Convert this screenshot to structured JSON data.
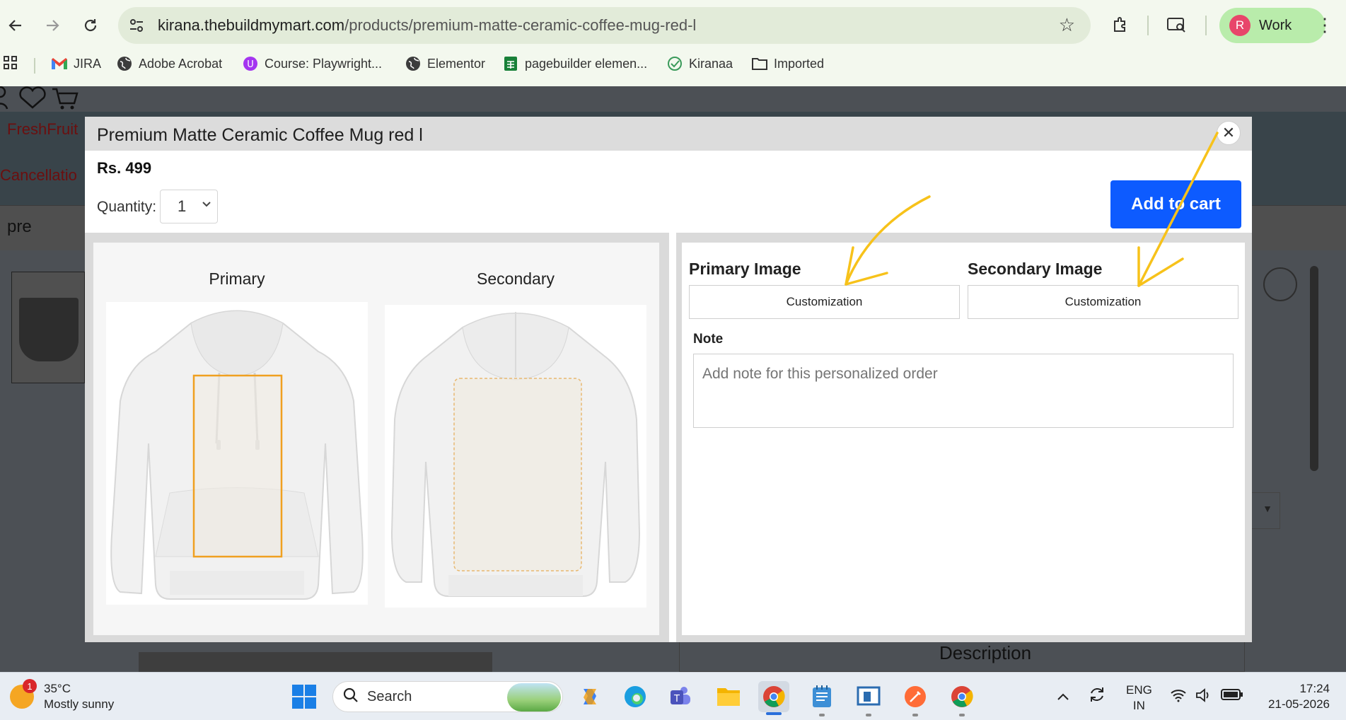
{
  "browser": {
    "url_host": "kirana.thebuildmymart.com",
    "url_path": "/products/premium-matte-ceramic-coffee-mug-red-l",
    "profile_initial": "R",
    "profile_label": "Work",
    "bookmarks": [
      {
        "label": "JIRA",
        "icon": "gmail-icon"
      },
      {
        "label": "Adobe Acrobat",
        "icon": "globe-icon"
      },
      {
        "label": "Course: Playwright...",
        "icon": "course-icon"
      },
      {
        "label": "Elementor",
        "icon": "globe-icon"
      },
      {
        "label": "pagebuilder elemen...",
        "icon": "sheets-icon"
      },
      {
        "label": "Kiranaa",
        "icon": "check-icon"
      },
      {
        "label": "Imported",
        "icon": "folder-icon"
      }
    ]
  },
  "background_page": {
    "category_link": "FreshFruit",
    "cancellation_link": "Cancellatio",
    "search_text": "pre",
    "description_heading": "Description"
  },
  "modal": {
    "title": "Premium Matte Ceramic Coffee Mug red l",
    "close_glyph": "✕",
    "price": "Rs. 499",
    "quantity_label": "Quantity:",
    "quantity_value": "1",
    "add_to_cart_label": "Add to cart",
    "views": {
      "primary_label": "Primary",
      "secondary_label": "Secondary"
    },
    "customization": {
      "primary_heading": "Primary Image",
      "secondary_heading": "Secondary Image",
      "primary_button": "Customization",
      "secondary_button": "Customization"
    },
    "note": {
      "label": "Note",
      "placeholder": "Add note for this personalized order"
    }
  },
  "taskbar": {
    "weather_badge": "1",
    "temperature": "35°C",
    "weather_desc": "Mostly sunny",
    "search_label": "Search",
    "lang_top": "ENG",
    "lang_bottom": "IN",
    "time": "17:24",
    "date": "21-05-2026"
  },
  "colors": {
    "accent_button": "#0d5bff",
    "annotation_arrow": "#f7c21a",
    "print_area_border": "#f0a020"
  }
}
